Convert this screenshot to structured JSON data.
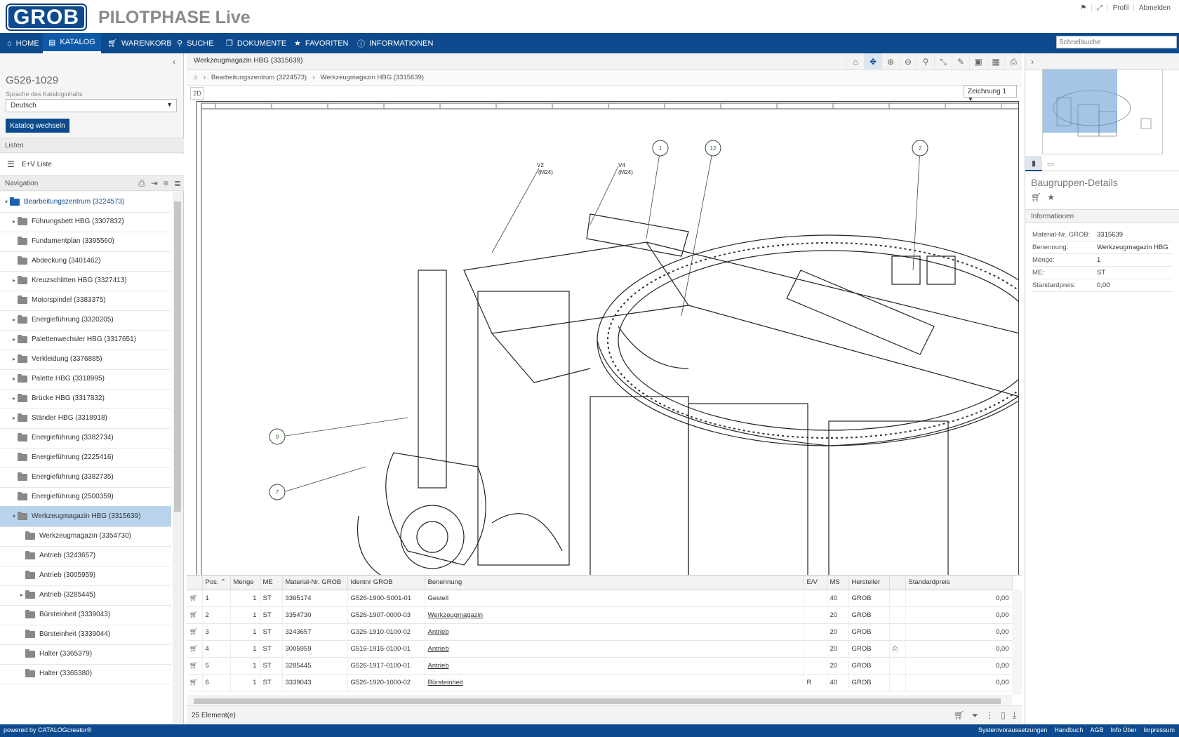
{
  "header": {
    "logo_text": "GROB",
    "app_title": "PILOTPHASE Live",
    "flag_icon": "flag-icon",
    "fullscreen_icon": "fullscreen-icon",
    "profile": "Profil",
    "logout": "Abmelden"
  },
  "nav": [
    {
      "label": "HOME",
      "icon": "home-icon"
    },
    {
      "label": "KATALOG",
      "icon": "book-icon"
    },
    {
      "label": "WARENKORB",
      "icon": "cart-icon"
    },
    {
      "label": "SUCHE",
      "icon": "search-icon"
    },
    {
      "label": "DOKUMENTE",
      "icon": "documents-icon"
    },
    {
      "label": "FAVORITEN",
      "icon": "star-icon"
    },
    {
      "label": "INFORMATIONEN",
      "icon": "info-icon"
    }
  ],
  "quick_search_placeholder": "Schnellsuche",
  "left": {
    "catalog_id": "G526-1029",
    "lang_label": "Sprache des Kataloginhalts",
    "lang_value": "Deutsch",
    "switch_button": "Katalog wechseln",
    "lists_head": "Listen",
    "ev_list": "E+V Liste",
    "navigation_head": "Navigation"
  },
  "tree": [
    {
      "label": "Bearbeitungszentrum (3224573)",
      "level": 0,
      "caret": "▾",
      "root": true
    },
    {
      "label": "Führungsbett HBG (3307832)",
      "level": 1,
      "caret": "▸"
    },
    {
      "label": "Fundamentplan (3395560)",
      "level": 1,
      "caret": ""
    },
    {
      "label": "Abdeckung (3401462)",
      "level": 1,
      "caret": ""
    },
    {
      "label": "Kreuzschlitten HBG (3327413)",
      "level": 1,
      "caret": "▸"
    },
    {
      "label": "Motorspindel (3383375)",
      "level": 1,
      "caret": ""
    },
    {
      "label": "Energieführung (3320205)",
      "level": 1,
      "caret": "▸"
    },
    {
      "label": "Palettenwechsler HBG (3317651)",
      "level": 1,
      "caret": "▸"
    },
    {
      "label": "Verkleidung (3376885)",
      "level": 1,
      "caret": "▸"
    },
    {
      "label": "Palette HBG (3318995)",
      "level": 1,
      "caret": "▸"
    },
    {
      "label": "Brücke HBG (3317832)",
      "level": 1,
      "caret": "▸"
    },
    {
      "label": "Ständer HBG (3318918)",
      "level": 1,
      "caret": "▸"
    },
    {
      "label": "Energieführung (3382734)",
      "level": 1,
      "caret": ""
    },
    {
      "label": "Energieführung (2225416)",
      "level": 1,
      "caret": ""
    },
    {
      "label": "Energieführung (3382735)",
      "level": 1,
      "caret": ""
    },
    {
      "label": "Energieführung (2500359)",
      "level": 1,
      "caret": ""
    },
    {
      "label": "Werkzeugmagazin HBG (3315639)",
      "level": 1,
      "caret": "▾",
      "selected": true
    },
    {
      "label": "Werkzeugmagazin (3354730)",
      "level": 2,
      "caret": ""
    },
    {
      "label": "Antrieb (3243657)",
      "level": 2,
      "caret": ""
    },
    {
      "label": "Antrieb (3005959)",
      "level": 2,
      "caret": ""
    },
    {
      "label": "Antrieb (3285445)",
      "level": 2,
      "caret": "▸"
    },
    {
      "label": "Bürsteinheit (3339043)",
      "level": 2,
      "caret": ""
    },
    {
      "label": "Bürsteinheit (3339044)",
      "level": 2,
      "caret": ""
    },
    {
      "label": "Halter (3365379)",
      "level": 2,
      "caret": ""
    },
    {
      "label": "Halter (3365380)",
      "level": 2,
      "caret": ""
    }
  ],
  "center": {
    "title": "Werkzeugmagazin HBG (3315639)",
    "breadcrumb": [
      "Bearbeitungszentrum (3224573)",
      "Werkzeugmagazin HBG (3315639)"
    ],
    "tab_2d": "2D",
    "drawing_select": "Zeichnung 1",
    "callouts": {
      "c1": "1",
      "c2": "12",
      "c3": "2",
      "c9": "9",
      "c7": "7",
      "v2": "V2",
      "v2b": "(M24)",
      "v4": "V4",
      "v4b": "(M24)"
    }
  },
  "table": {
    "columns": [
      "",
      "Pos.",
      "Menge",
      "ME",
      "Material-Nr. GROB",
      "Identnr GROB",
      "Benennung",
      "E/V",
      "MS",
      "Hersteller",
      "",
      "Standardpreis"
    ],
    "rows": [
      {
        "pos": "1",
        "menge": "1",
        "me": "ST",
        "mat": "3365174",
        "ident": "G526-1900-S001-01",
        "name": "Gestell",
        "link": false,
        "ev": "",
        "ms": "40",
        "hersteller": "GROB",
        "doc": "",
        "preis": "0,00"
      },
      {
        "pos": "2",
        "menge": "1",
        "me": "ST",
        "mat": "3354730",
        "ident": "G526-1907-0000-03",
        "name": "Werkzeugmagazin",
        "link": true,
        "ev": "",
        "ms": "20",
        "hersteller": "GROB",
        "doc": "",
        "preis": "0,00"
      },
      {
        "pos": "3",
        "menge": "1",
        "me": "ST",
        "mat": "3243657",
        "ident": "G326-1910-0100-02",
        "name": "Antrieb",
        "link": true,
        "ev": "",
        "ms": "20",
        "hersteller": "GROB",
        "doc": "",
        "preis": "0,00"
      },
      {
        "pos": "4",
        "menge": "1",
        "me": "ST",
        "mat": "3005959",
        "ident": "G516-1915-0100-01",
        "name": "Antrieb",
        "link": true,
        "ev": "",
        "ms": "20",
        "hersteller": "GROB",
        "doc": "pdf-icon",
        "preis": "0,00"
      },
      {
        "pos": "5",
        "menge": "1",
        "me": "ST",
        "mat": "3285445",
        "ident": "G526-1917-0100-01",
        "name": "Antrieb",
        "link": true,
        "ev": "",
        "ms": "20",
        "hersteller": "GROB",
        "doc": "",
        "preis": "0,00"
      },
      {
        "pos": "6",
        "menge": "1",
        "me": "ST",
        "mat": "3339043",
        "ident": "G526-1920-1000-02",
        "name": "Bürsteinheit",
        "link": true,
        "ev": "R",
        "ms": "40",
        "hersteller": "GROB",
        "doc": "",
        "preis": "0,00"
      }
    ],
    "count": "25 Element(e)"
  },
  "right": {
    "detail_title": "Baugruppen-Details",
    "info_head": "Informationen",
    "info": [
      {
        "k": "Material-Nr. GROB:",
        "v": "3315639"
      },
      {
        "k": "Benennung:",
        "v": "Werkzeugmagazin HBG"
      },
      {
        "k": "Menge:",
        "v": "1"
      },
      {
        "k": "ME:",
        "v": "ST"
      },
      {
        "k": "Standardpreis:",
        "v": "0,00"
      }
    ]
  },
  "footer": {
    "powered": "powered by CATALOGcreator®",
    "links": [
      "Systemvoraussetzungen",
      "Handbuch",
      "AGB",
      "Info Über",
      "Impressum"
    ]
  }
}
